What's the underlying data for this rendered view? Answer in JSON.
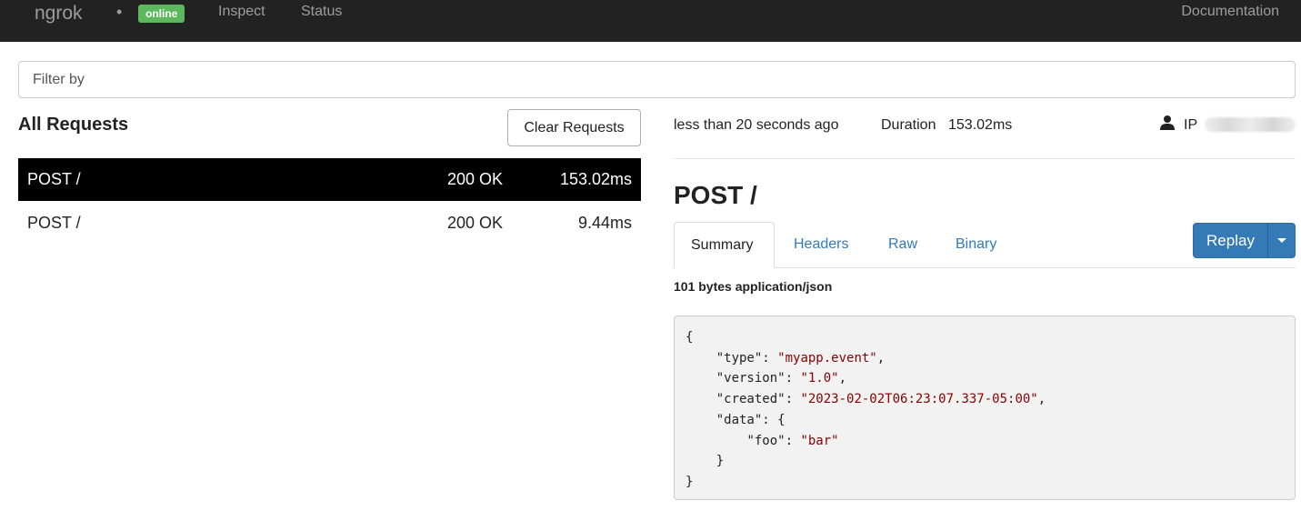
{
  "navbar": {
    "brand": "ngrok",
    "separator": "•",
    "status_badge": "online",
    "links": [
      "Inspect",
      "Status"
    ],
    "documentation": "Documentation"
  },
  "filter": {
    "placeholder": "Filter by",
    "value": ""
  },
  "requests": {
    "heading": "All Requests",
    "clear_label": "Clear Requests",
    "rows": [
      {
        "method_path": "POST /",
        "status": "200 OK",
        "duration": "153.02ms",
        "selected": true
      },
      {
        "method_path": "POST /",
        "status": "200 OK",
        "duration": "9.44ms",
        "selected": false
      }
    ]
  },
  "detail": {
    "time_ago": "less than 20 seconds ago",
    "duration_label": "Duration",
    "duration_value": "153.02ms",
    "ip_label": "IP",
    "title": "POST /",
    "tabs": [
      "Summary",
      "Headers",
      "Raw",
      "Binary"
    ],
    "active_tab": "Summary",
    "replay_label": "Replay",
    "body_meta": "101 bytes application/json",
    "json": {
      "open": "{",
      "type_key": "\"type\"",
      "type_val": "\"myapp.event\"",
      "version_key": "\"version\"",
      "version_val": "\"1.0\"",
      "created_key": "\"created\"",
      "created_val": "\"2023-02-02T06:23:07.337-05:00\"",
      "data_key": "\"data\"",
      "data_open": "{",
      "foo_key": "\"foo\"",
      "foo_val": "\"bar\"",
      "data_close": "}",
      "close": "}"
    }
  },
  "colors": {
    "navbar_bg": "#222222",
    "badge_green": "#5cb85c",
    "link_blue": "#337ab7",
    "selected_row_bg": "#000000",
    "string_red": "#880000"
  },
  "icons": {
    "user": "user-icon",
    "caret": "caret-down-icon"
  }
}
